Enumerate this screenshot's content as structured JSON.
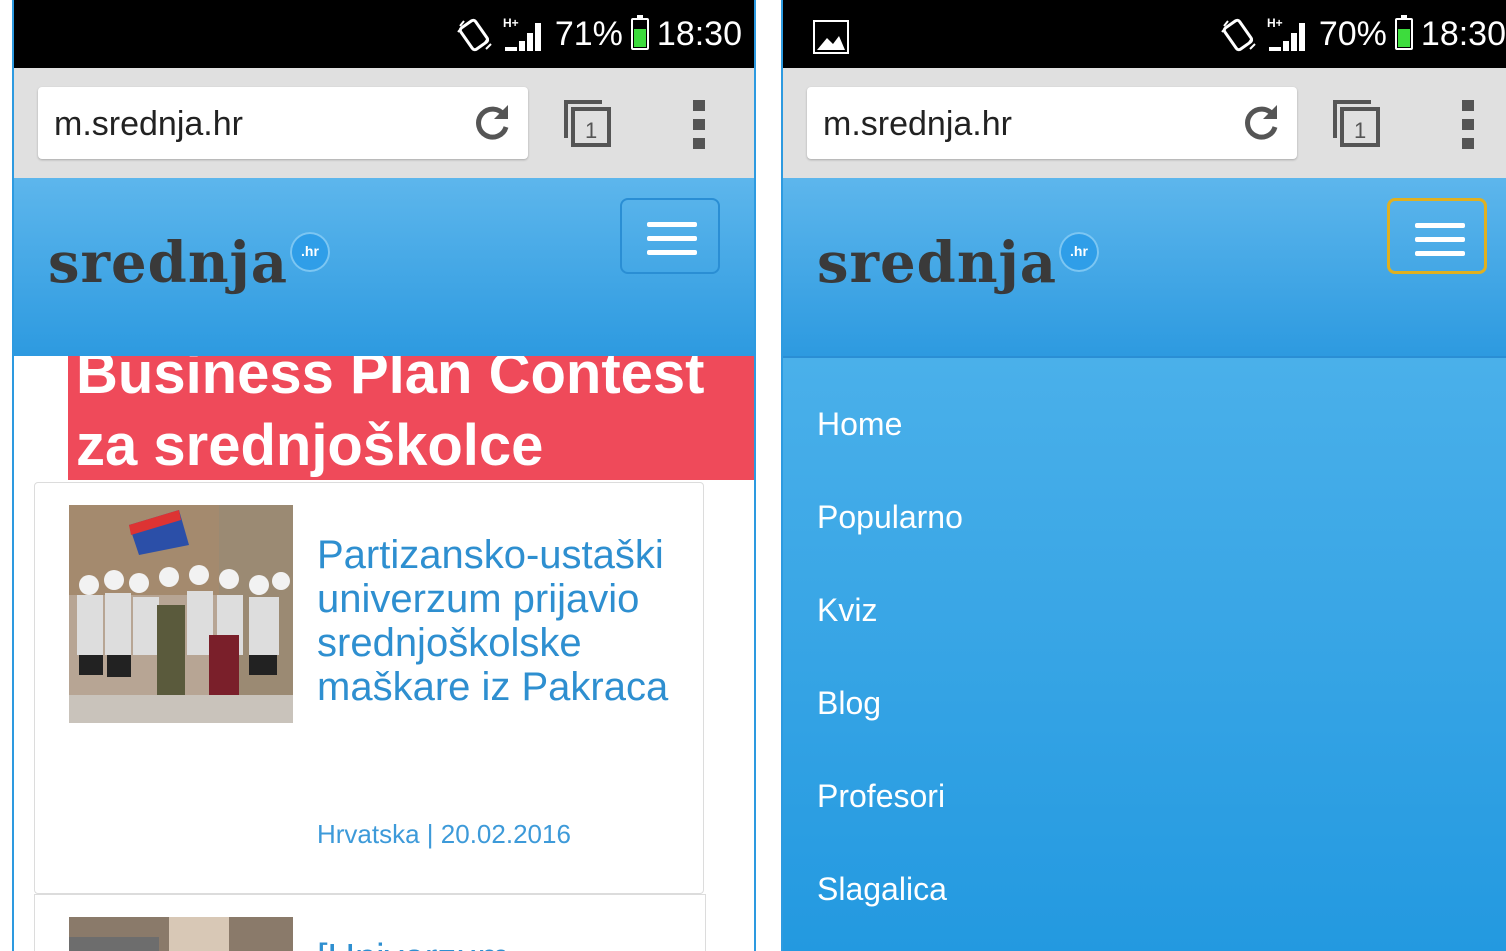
{
  "left_screen": {
    "status": {
      "battery_pct": "71%",
      "time": "18:30",
      "battery_level": 0.71
    },
    "browser": {
      "url": "m.srednja.hr"
    },
    "site": {
      "logo_text": "srednja",
      "logo_badge": ".hr"
    },
    "banner": {
      "line1": "Business Plan Contest",
      "line2": "za srednjoškolce"
    },
    "articles": [
      {
        "title": "Partizansko-ustaški univerzum prijavio srednjoškolske maškare iz Pakraca",
        "meta": "Hrvatska | 20.02.2016"
      },
      {
        "title": "[Univerzum..."
      }
    ]
  },
  "right_screen": {
    "status": {
      "battery_pct": "70%",
      "time": "18:30",
      "battery_level": 0.7
    },
    "browser": {
      "url": "m.srednja.hr"
    },
    "site": {
      "logo_text": "srednja",
      "logo_badge": ".hr"
    },
    "nav": [
      "Home",
      "Popularno",
      "Kviz",
      "Blog",
      "Profesori",
      "Slagalica"
    ]
  },
  "colors": {
    "header_blue": "#2d9ae0",
    "link_blue": "#2e8fd0",
    "banner_red": "#ef4a5a",
    "focus_outline": "#e0b020"
  },
  "icons": [
    "vibrate-icon",
    "signal-hplus-icon",
    "battery-icon",
    "image-notification-icon",
    "reload-icon",
    "tabs-icon",
    "overflow-menu-icon",
    "hamburger-menu-icon"
  ]
}
